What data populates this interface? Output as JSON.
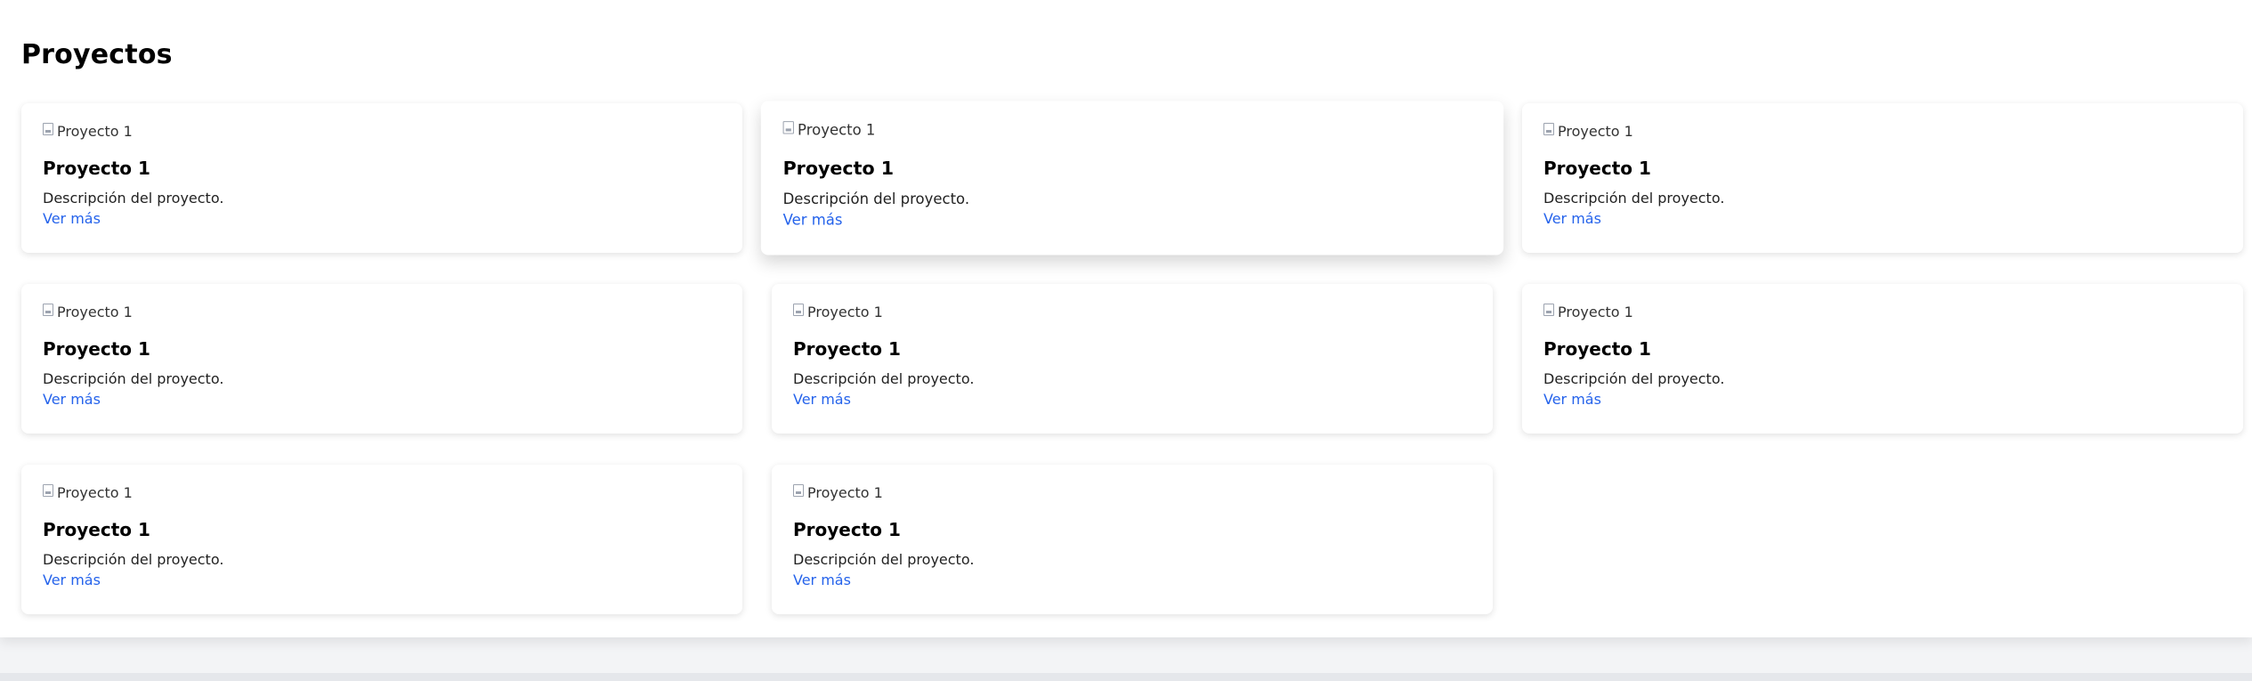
{
  "section": {
    "title": "Proyectos"
  },
  "projects": [
    {
      "image_alt": "Proyecto 1",
      "title": "Proyecto 1",
      "description": "Descripción del proyecto.",
      "link": "Ver más"
    },
    {
      "image_alt": "Proyecto 1",
      "title": "Proyecto 1",
      "description": "Descripción del proyecto.",
      "link": "Ver más"
    },
    {
      "image_alt": "Proyecto 1",
      "title": "Proyecto 1",
      "description": "Descripción del proyecto.",
      "link": "Ver más"
    },
    {
      "image_alt": "Proyecto 1",
      "title": "Proyecto 1",
      "description": "Descripción del proyecto.",
      "link": "Ver más"
    },
    {
      "image_alt": "Proyecto 1",
      "title": "Proyecto 1",
      "description": "Descripción del proyecto.",
      "link": "Ver más"
    },
    {
      "image_alt": "Proyecto 1",
      "title": "Proyecto 1",
      "description": "Descripción del proyecto.",
      "link": "Ver más"
    },
    {
      "image_alt": "Proyecto 1",
      "title": "Proyecto 1",
      "description": "Descripción del proyecto.",
      "link": "Ver más"
    },
    {
      "image_alt": "Proyecto 1",
      "title": "Proyecto 1",
      "description": "Descripción del proyecto.",
      "link": "Ver más"
    }
  ],
  "colors": {
    "link": "#2563eb",
    "background": "#ffffff"
  }
}
